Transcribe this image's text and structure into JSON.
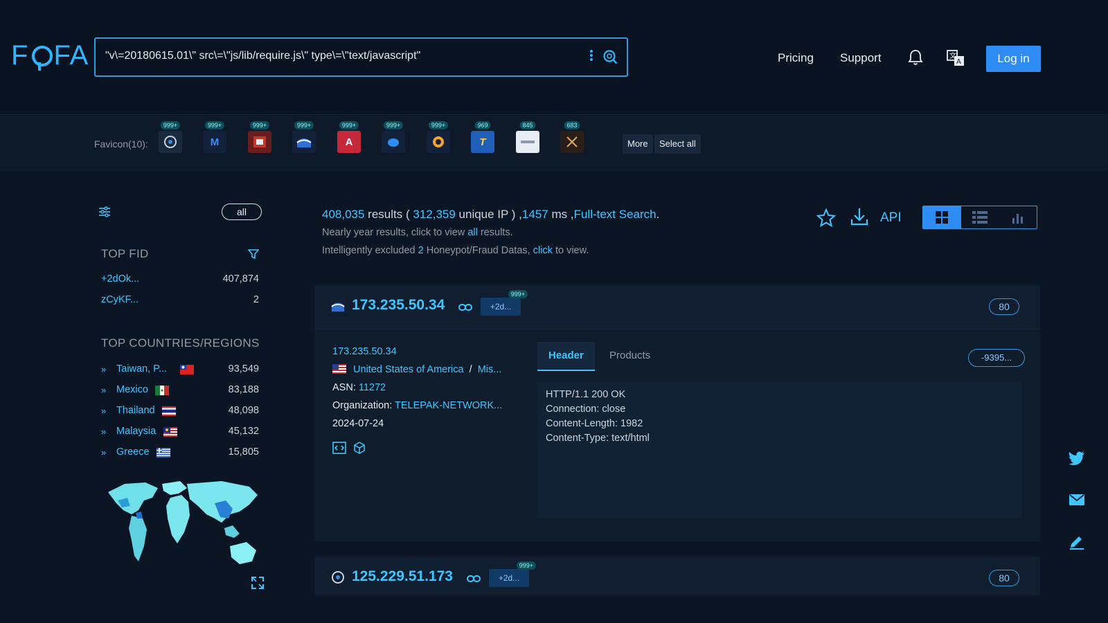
{
  "header": {
    "logo": "FOFA",
    "search_query": "\"v\\=20180615.01\\\" src\\=\\\"js/lib/require.js\\\" type\\=\\\"text/javascript\"",
    "nav": [
      "Pricing",
      "Support"
    ],
    "login_label": "Log in",
    "accent": "#2fb6ff"
  },
  "favicons": {
    "label": "Favicon(10):",
    "items": [
      {
        "count": "999+",
        "icon": "compass-icon"
      },
      {
        "count": "999+",
        "icon": "m-logo-icon"
      },
      {
        "count": "999+",
        "icon": "red-square-icon"
      },
      {
        "count": "999+",
        "icon": "wave-logo-icon"
      },
      {
        "count": "999+",
        "icon": "red-a-logo-icon"
      },
      {
        "count": "999+",
        "icon": "blue-drop-icon"
      },
      {
        "count": "999+",
        "icon": "orange-q-icon"
      },
      {
        "count": "969",
        "icon": "t-logo-icon"
      },
      {
        "count": "845",
        "icon": "white-bar-icon"
      },
      {
        "count": "683",
        "icon": "x-logo-icon"
      }
    ],
    "more_label": "More",
    "select_all_label": "Select all"
  },
  "sidebar": {
    "all_label": "all",
    "top_fid": {
      "title": "TOP FID",
      "rows": [
        {
          "key": "+2dOk...",
          "value": "407,874"
        },
        {
          "key": "zCyKF...",
          "value": "2"
        }
      ]
    },
    "top_countries": {
      "title": "TOP COUNTRIES/REGIONS",
      "rows": [
        {
          "name": "Taiwan, P...",
          "value": "93,549"
        },
        {
          "name": "Mexico",
          "value": "83,188"
        },
        {
          "name": "Thailand",
          "value": "48,098"
        },
        {
          "name": "Malaysia",
          "value": "45,132"
        },
        {
          "name": "Greece",
          "value": "15,805"
        }
      ]
    }
  },
  "summary": {
    "results": "408,035",
    "results_word": " results ( ",
    "unique_ip": "312,359",
    "unique_word": " unique IP ) ,",
    "ms": "1457",
    "ms_word": " ms ,",
    "fulltext": "Full-text Search",
    "dot": ".",
    "line2_pre": "Nearly year results, click to view ",
    "line2_link": "all",
    "line2_post": " results.",
    "line3_pre": "Intelligently excluded ",
    "line3_num": "2",
    "line3_mid": " Honeypot/Fraud Datas, ",
    "line3_link": "click",
    "line3_post": " to view.",
    "api_label": "API"
  },
  "results": [
    {
      "ip": "173.235.50.34",
      "fid_tag": "+2d...",
      "fid_count": "999+",
      "port": "80",
      "ip_link": "173.235.50.34",
      "country": "United States of America",
      "sep": "/",
      "region": "Mis...",
      "asn_label": "ASN:",
      "asn": "11272",
      "org_label": "Organization:",
      "org": "TELEPAK-NETWORK...",
      "date": "2024-07-24",
      "tab_header": "Header",
      "tab_products": "Products",
      "fid_pill": "-9395...",
      "header_lines": [
        "HTTP/1.1 200 OK",
        "Connection: close",
        "Content-Length: 1982",
        "Content-Type: text/html"
      ]
    },
    {
      "ip": "125.229.51.173",
      "fid_tag": "+2d...",
      "fid_count": "999+",
      "port": "80"
    }
  ]
}
